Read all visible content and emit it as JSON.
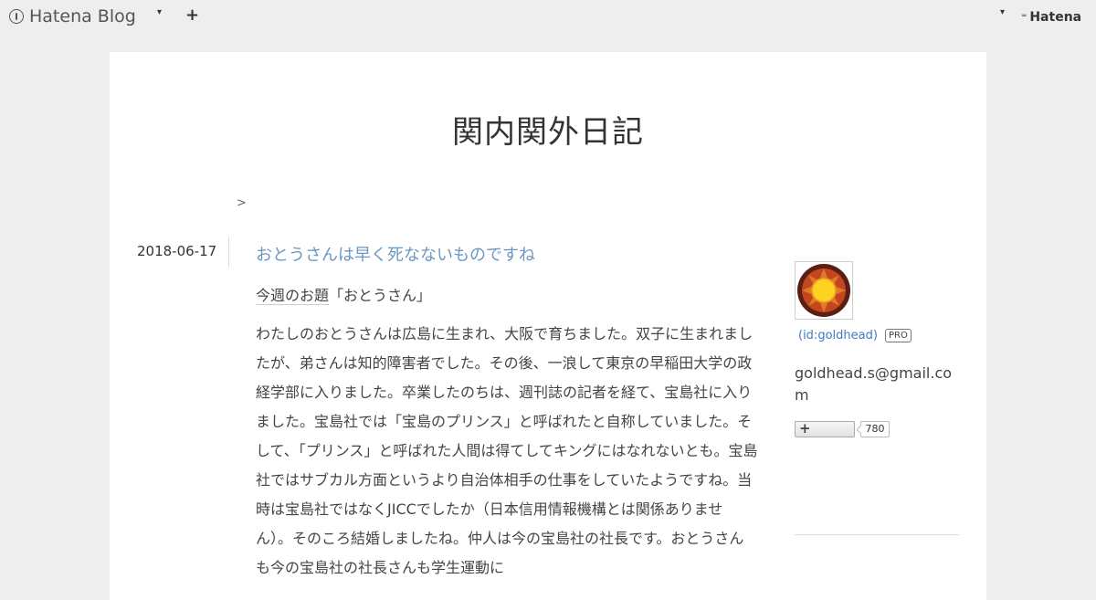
{
  "header": {
    "logo_text": "Hatena Blog",
    "add_label": "+",
    "caret": "▾",
    "hatena_label": "Hatena"
  },
  "blog": {
    "title": "関内関外日記"
  },
  "breadcrumb": ">",
  "entry": {
    "date": "2018-06-17",
    "title": "おとうさんは早く死なないものですね",
    "topic_link": "今週のお題",
    "topic_text": "「おとうさん」",
    "body": "わたしのおとうさんは広島に生まれ、大阪で育ちました。双子に生まれましたが、弟さんは知的障害者でした。その後、一浪して東京の早稲田大学の政経学部に入りました。卒業したのちは、週刊誌の記者を経て、宝島社に入りました。宝島社では「宝島のプリンス」と呼ばれたと自称していました。そして、「プリンス」と呼ばれた人間は得てしてキングにはなれないとも。宝島社ではサブカル方面というより自治体相手の仕事をしていたようですね。当時は宝島社ではなくJICCでしたか（日本信用情報機構とは関係ありません）。そのころ結婚しましたね。仲人は今の宝島社の社長です。おとうさんも今の宝島社の社長さんも学生運動に"
  },
  "sidebar": {
    "profile_id": "(id:goldhead)",
    "pro_badge": "PRO",
    "email": "goldhead.s@gmail.com",
    "follow_plus": "+",
    "follow_count": "780"
  },
  "colors": {
    "background": "#eeeeee",
    "card": "#ffffff",
    "link": "#6b97c4",
    "id_link": "#3f7bbf"
  }
}
